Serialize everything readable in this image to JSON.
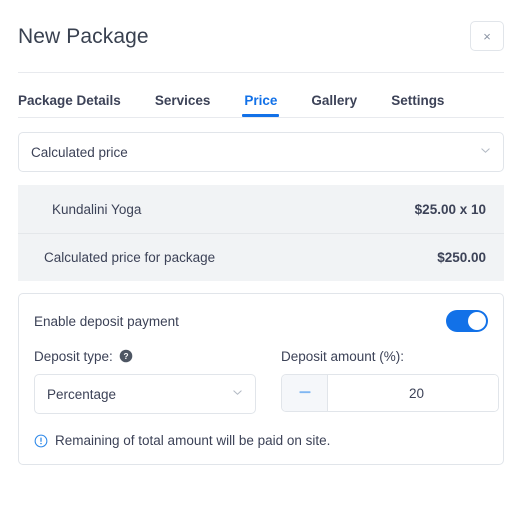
{
  "header": {
    "title": "New Package",
    "close_label": "×"
  },
  "tabs": [
    {
      "label": "Package Details",
      "active": false
    },
    {
      "label": "Services",
      "active": false
    },
    {
      "label": "Price",
      "active": true
    },
    {
      "label": "Gallery",
      "active": false
    },
    {
      "label": "Settings",
      "active": false
    }
  ],
  "price": {
    "mode_select": {
      "value": "Calculated price",
      "icon": "chevron-down-icon"
    },
    "rows": [
      {
        "label": "Kundalini Yoga",
        "amount": "$25.00 x 10"
      },
      {
        "label": "Calculated price for package",
        "amount": "$250.00"
      }
    ]
  },
  "deposit": {
    "enable_label": "Enable deposit payment",
    "toggle_on": true,
    "type_label": "Deposit type:",
    "type_help_icon": "question-mark-icon",
    "type_value": "Percentage",
    "amount_label": "Deposit amount (%):",
    "amount_value": "20",
    "decrement_label": "−",
    "increment_label": "+",
    "note_icon": "info-exclamation-icon",
    "note_text": "Remaining of total amount will be paid on site."
  },
  "colors": {
    "accent": "#1271e8",
    "text": "#3c4257",
    "row_background": "#f1f3f5",
    "border": "#e1e5ea",
    "stepper_button_background": "#f5f7fa",
    "minus_icon": "#7fb6f2",
    "plus_icon": "#3d95f0"
  }
}
